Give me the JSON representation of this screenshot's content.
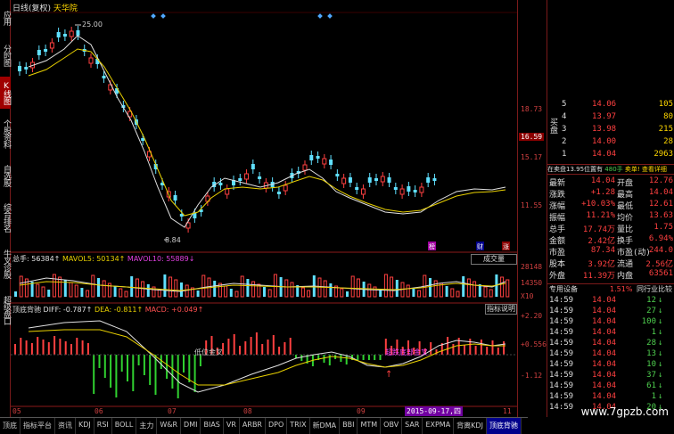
{
  "left_tabs": [
    {
      "label": "应用",
      "active": false
    },
    {
      "label": "分时图",
      "active": false
    },
    {
      "label": "K线图",
      "active": true
    },
    {
      "label": "个股资料",
      "active": false
    },
    {
      "label": "自选股",
      "active": false
    },
    {
      "label": "综合排名",
      "active": false
    },
    {
      "label": "牛叉诊股",
      "active": false
    },
    {
      "label": "超级盘口",
      "active": false
    }
  ],
  "header": {
    "mode": "日线(复权)",
    "name": "天华院"
  },
  "annotations": {
    "high": "25.00",
    "low": "8.84",
    "cross1": "低位金叉",
    "cross2": "超跌底部金叉"
  },
  "price_axis": [
    "18.73",
    "16.59",
    "15.17",
    "11.55"
  ],
  "vol_axis": [
    "28148",
    "14350",
    "X10"
  ],
  "macd_axis": [
    "+2.20",
    "+0.556",
    "-1.12"
  ],
  "volume_header": {
    "total": "总手: 56384↑",
    "mavol5": "MAVOL5: 50134↑",
    "mavol10": "MAVOL10: 55889↓",
    "unit_btn": "成交量"
  },
  "macd_header": {
    "name": "顶底背驰",
    "diff": "DIFF: -0.787↑",
    "dea": "DEA: -0.811↑",
    "macd": "MACD: +0.049↑",
    "explain_btn": "指标说明"
  },
  "date_axis": [
    "05",
    "06",
    "07",
    "08",
    "09",
    "2015-09-17,四",
    "11"
  ],
  "quote": {
    "sell": [
      {
        "lvl": "5",
        "price": "14.06",
        "vol": "105"
      },
      {
        "lvl": "4",
        "price": "13.97",
        "vol": "80"
      },
      {
        "lvl": "3",
        "price": "13.98",
        "vol": "215"
      },
      {
        "lvl": "2",
        "price": "14.00",
        "vol": "28"
      },
      {
        "lvl": "1",
        "price": "14.04",
        "vol": "2963"
      }
    ],
    "sell_label": "买盘",
    "buy_info": "在卖盘13.95位置有",
    "buy_num": "480手",
    "buy_extra": "卖单! 查看详细",
    "stats": [
      {
        "k1": "最新",
        "v1": "14.04",
        "k2": "开盘",
        "v2": "12.76"
      },
      {
        "k1": "涨跌",
        "v1": "+1.28",
        "k2": "最高",
        "v2": "14.04"
      },
      {
        "k1": "涨幅",
        "v1": "+10.03%",
        "k2": "最低",
        "v2": "12.61"
      },
      {
        "k1": "振幅",
        "v1": "11.21%",
        "k2": "均价",
        "v2": "13.63"
      },
      {
        "k1": "总手",
        "v1": "17.74万",
        "k2": "量比",
        "v2": "1.75"
      },
      {
        "k1": "金额",
        "v1": "2.42亿",
        "k2": "换手",
        "v2": "6.94%"
      },
      {
        "k1": "市盈",
        "v1": "87.34",
        "k2": "市盈(动)",
        "v2": "244.0"
      },
      {
        "k1": "股本",
        "v1": "3.92亿",
        "k2": "流通",
        "v2": "2.56亿"
      },
      {
        "k1": "外盘",
        "v1": "11.39万",
        "k2": "内盘",
        "v2": "63561"
      }
    ],
    "industry": {
      "label": "专用设备",
      "pct": "1.51%",
      "btn": "同行业比较"
    },
    "ticks": [
      {
        "t": "14:59",
        "p": "14.04",
        "v": "12"
      },
      {
        "t": "14:59",
        "p": "14.04",
        "v": "27"
      },
      {
        "t": "14:59",
        "p": "14.04",
        "v": "100"
      },
      {
        "t": "14:59",
        "p": "14.04",
        "v": "1"
      },
      {
        "t": "14:59",
        "p": "14.04",
        "v": "28"
      },
      {
        "t": "14:59",
        "p": "14.04",
        "v": "13"
      },
      {
        "t": "14:59",
        "p": "14.04",
        "v": "10"
      },
      {
        "t": "14:59",
        "p": "14.04",
        "v": "37"
      },
      {
        "t": "14:59",
        "p": "14.04",
        "v": "61"
      },
      {
        "t": "14:59",
        "p": "14.04",
        "v": "1"
      },
      {
        "t": "14:59",
        "p": "14.04",
        "v": "20"
      }
    ]
  },
  "bottom_tabs": [
    {
      "label": "顶底",
      "active": false
    },
    {
      "label": "指标平台",
      "active": false
    },
    {
      "label": "资讯",
      "active": false
    },
    {
      "label": "KDJ",
      "active": false
    },
    {
      "label": "RSI",
      "active": false
    },
    {
      "label": "BOLL",
      "active": false
    },
    {
      "label": "主力",
      "active": false
    },
    {
      "label": "W&R",
      "active": false
    },
    {
      "label": "DMI",
      "active": false
    },
    {
      "label": "BIAS",
      "active": false
    },
    {
      "label": "VR",
      "active": false
    },
    {
      "label": "ARBR",
      "active": false
    },
    {
      "label": "DPO",
      "active": false
    },
    {
      "label": "TRIX",
      "active": false
    },
    {
      "label": "新DMA",
      "active": false
    },
    {
      "label": "BBI",
      "active": false
    },
    {
      "label": "MTM",
      "active": false
    },
    {
      "label": "OBV",
      "active": false
    },
    {
      "label": "SAR",
      "active": false
    },
    {
      "label": "EXPMA",
      "active": false
    },
    {
      "label": "背离KDJ",
      "active": false
    },
    {
      "label": "顶底背驰",
      "active": true
    }
  ],
  "watermark": "www.7gpzb.com"
}
